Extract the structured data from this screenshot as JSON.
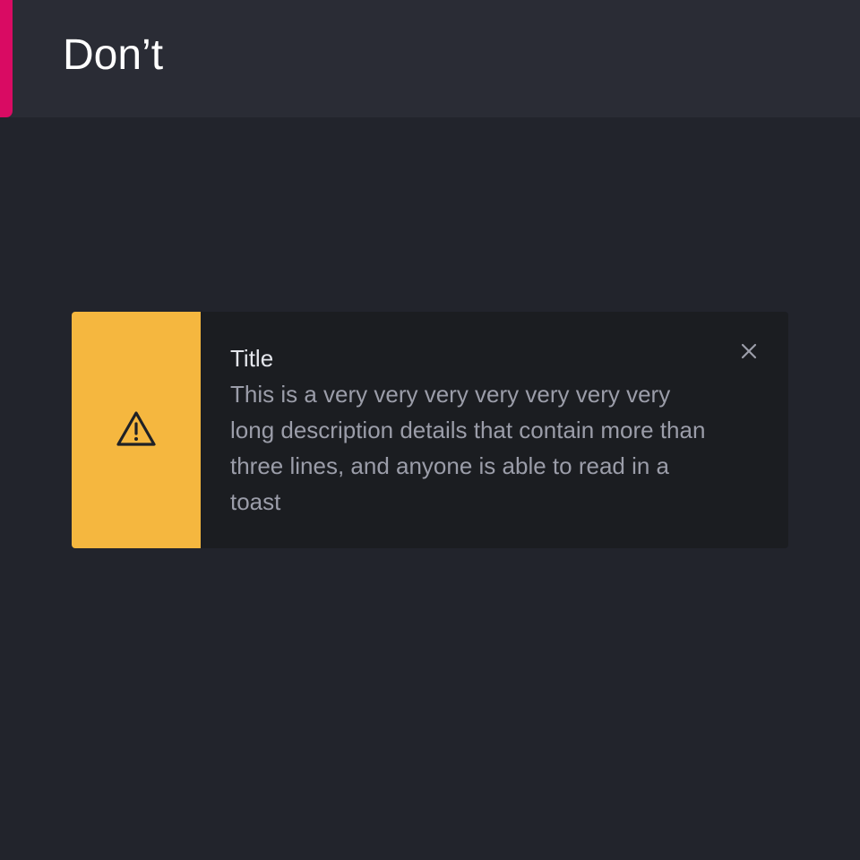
{
  "header": {
    "title": "Don’t",
    "accent_color": "#d90b63"
  },
  "toast": {
    "variant": "warning",
    "icon": "warning-triangle-icon",
    "accent_color": "#f5b73f",
    "title": "Title",
    "description": "This is a very very very very very very very long description details that contain more than three lines, and anyone is able to read in a toast",
    "close_icon": "close-icon"
  }
}
